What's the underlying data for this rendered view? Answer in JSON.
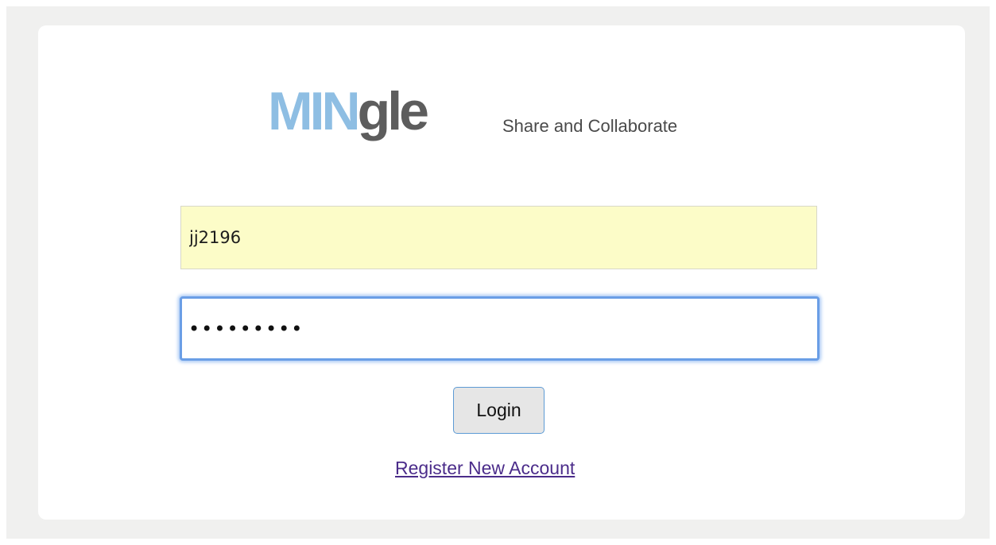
{
  "logo": {
    "part1": "MIN",
    "part2": "gle",
    "tagline": "Share and Collaborate"
  },
  "form": {
    "username_value": "jj2196",
    "password_value": "•••••••••",
    "login_label": "Login",
    "register_label": "Register New Account"
  },
  "colors": {
    "logo_accent": "#8ebee3",
    "logo_dark": "#5d5d5d",
    "autofill_bg": "#fcfcc8",
    "focus_ring": "#6a9ee6",
    "link": "#4b2c8a"
  }
}
